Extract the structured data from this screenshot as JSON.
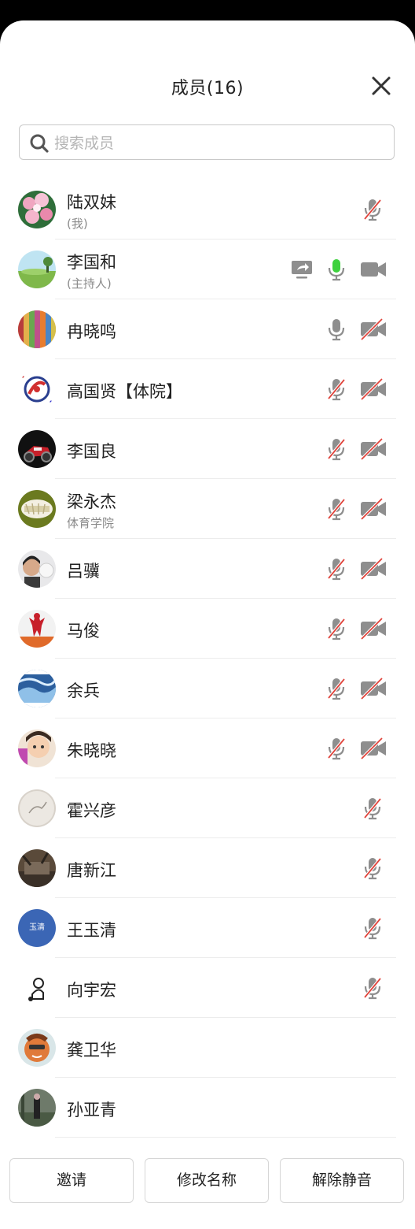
{
  "header": {
    "title": "成员(16)"
  },
  "search": {
    "placeholder": "搜索成员",
    "value": ""
  },
  "members": [
    {
      "name": "陆双妹",
      "sub": "(我)",
      "icons": [
        "mic-muted-icon"
      ]
    },
    {
      "name": "李国和",
      "sub": "(主持人)",
      "icons": [
        "screen-share-icon",
        "mic-active-icon",
        "camera-on-icon"
      ]
    },
    {
      "name": "冉晓鸣",
      "sub": "",
      "icons": [
        "mic-icon",
        "camera-off-icon"
      ]
    },
    {
      "name": "高国贤【体院】",
      "sub": "",
      "icons": [
        "mic-muted-icon",
        "camera-off-icon"
      ]
    },
    {
      "name": "李国良",
      "sub": "",
      "icons": [
        "mic-muted-icon",
        "camera-off-icon"
      ]
    },
    {
      "name": "梁永杰",
      "sub": "体育学院",
      "icons": [
        "mic-muted-icon",
        "camera-off-icon"
      ]
    },
    {
      "name": "吕骥",
      "sub": "",
      "icons": [
        "mic-muted-icon",
        "camera-off-icon"
      ]
    },
    {
      "name": "马俊",
      "sub": "",
      "icons": [
        "mic-muted-icon",
        "camera-off-icon"
      ]
    },
    {
      "name": "余兵",
      "sub": "",
      "icons": [
        "mic-muted-icon",
        "camera-off-icon"
      ]
    },
    {
      "name": "朱晓晓",
      "sub": "",
      "icons": [
        "mic-muted-icon",
        "camera-off-icon"
      ]
    },
    {
      "name": "霍兴彦",
      "sub": "",
      "icons": [
        "mic-muted-icon"
      ]
    },
    {
      "name": "唐新江",
      "sub": "",
      "icons": [
        "mic-muted-icon"
      ]
    },
    {
      "name": "王玉清",
      "sub": "",
      "avatar_text": "玉清",
      "icons": [
        "mic-muted-icon"
      ]
    },
    {
      "name": "向宇宏",
      "sub": "",
      "icons": [
        "mic-muted-icon"
      ]
    },
    {
      "name": "龚卫华",
      "sub": "",
      "icons": []
    },
    {
      "name": "孙亚青",
      "sub": "",
      "icons": []
    }
  ],
  "footer": {
    "invite": "邀请",
    "rename": "修改名称",
    "unmute": "解除静音"
  },
  "colors": {
    "mic_active": "#3dd13d",
    "muted_slash": "#e0443c",
    "icon_gray": "#8e8e8e"
  }
}
